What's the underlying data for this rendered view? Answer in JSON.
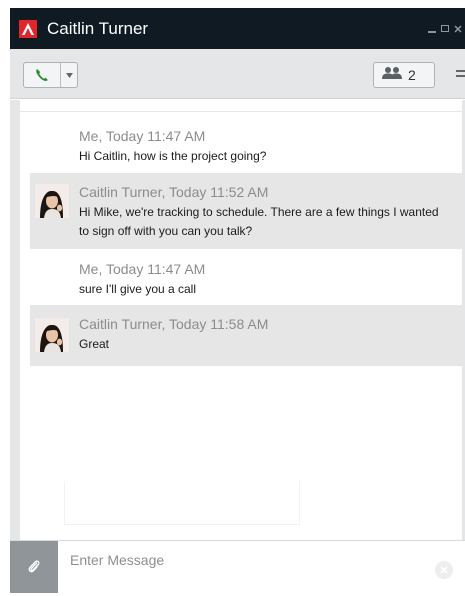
{
  "window": {
    "title": "Caitlin Turner"
  },
  "toolbar": {
    "participant_count": "2"
  },
  "messages": [
    {
      "sender": "Me",
      "meta": "Me, Today 11:47 AM",
      "text": "Hi Caitlin, how is the project going?",
      "has_avatar": false
    },
    {
      "sender": "Caitlin Turner",
      "meta": "Caitlin Turner, Today 11:52 AM",
      "text": "Hi Mike, we're tracking to schedule.  There are a few things I wanted to sign off with you can you talk?",
      "has_avatar": true
    },
    {
      "sender": "Me",
      "meta": "Me, Today 11:47 AM",
      "text": "sure  I'll give you a call",
      "has_avatar": false
    },
    {
      "sender": "Caitlin Turner",
      "meta": "Caitlin Turner, Today 11:58 AM",
      "text": "Great",
      "has_avatar": true
    }
  ],
  "composer": {
    "placeholder": "Enter Message"
  },
  "colors": {
    "titlebar": "#0f1a22",
    "brand_red": "#e0262b",
    "call_green": "#2c8a2f",
    "other_message_bg": "#e6e6e6",
    "attach_button": "#8f9599"
  },
  "icons": [
    "app-logo-icon",
    "phone-icon",
    "chevron-down-icon",
    "people-icon",
    "menu-icon",
    "paperclip-icon",
    "clear-icon",
    "minimize-icon",
    "maximize-icon",
    "close-icon"
  ]
}
